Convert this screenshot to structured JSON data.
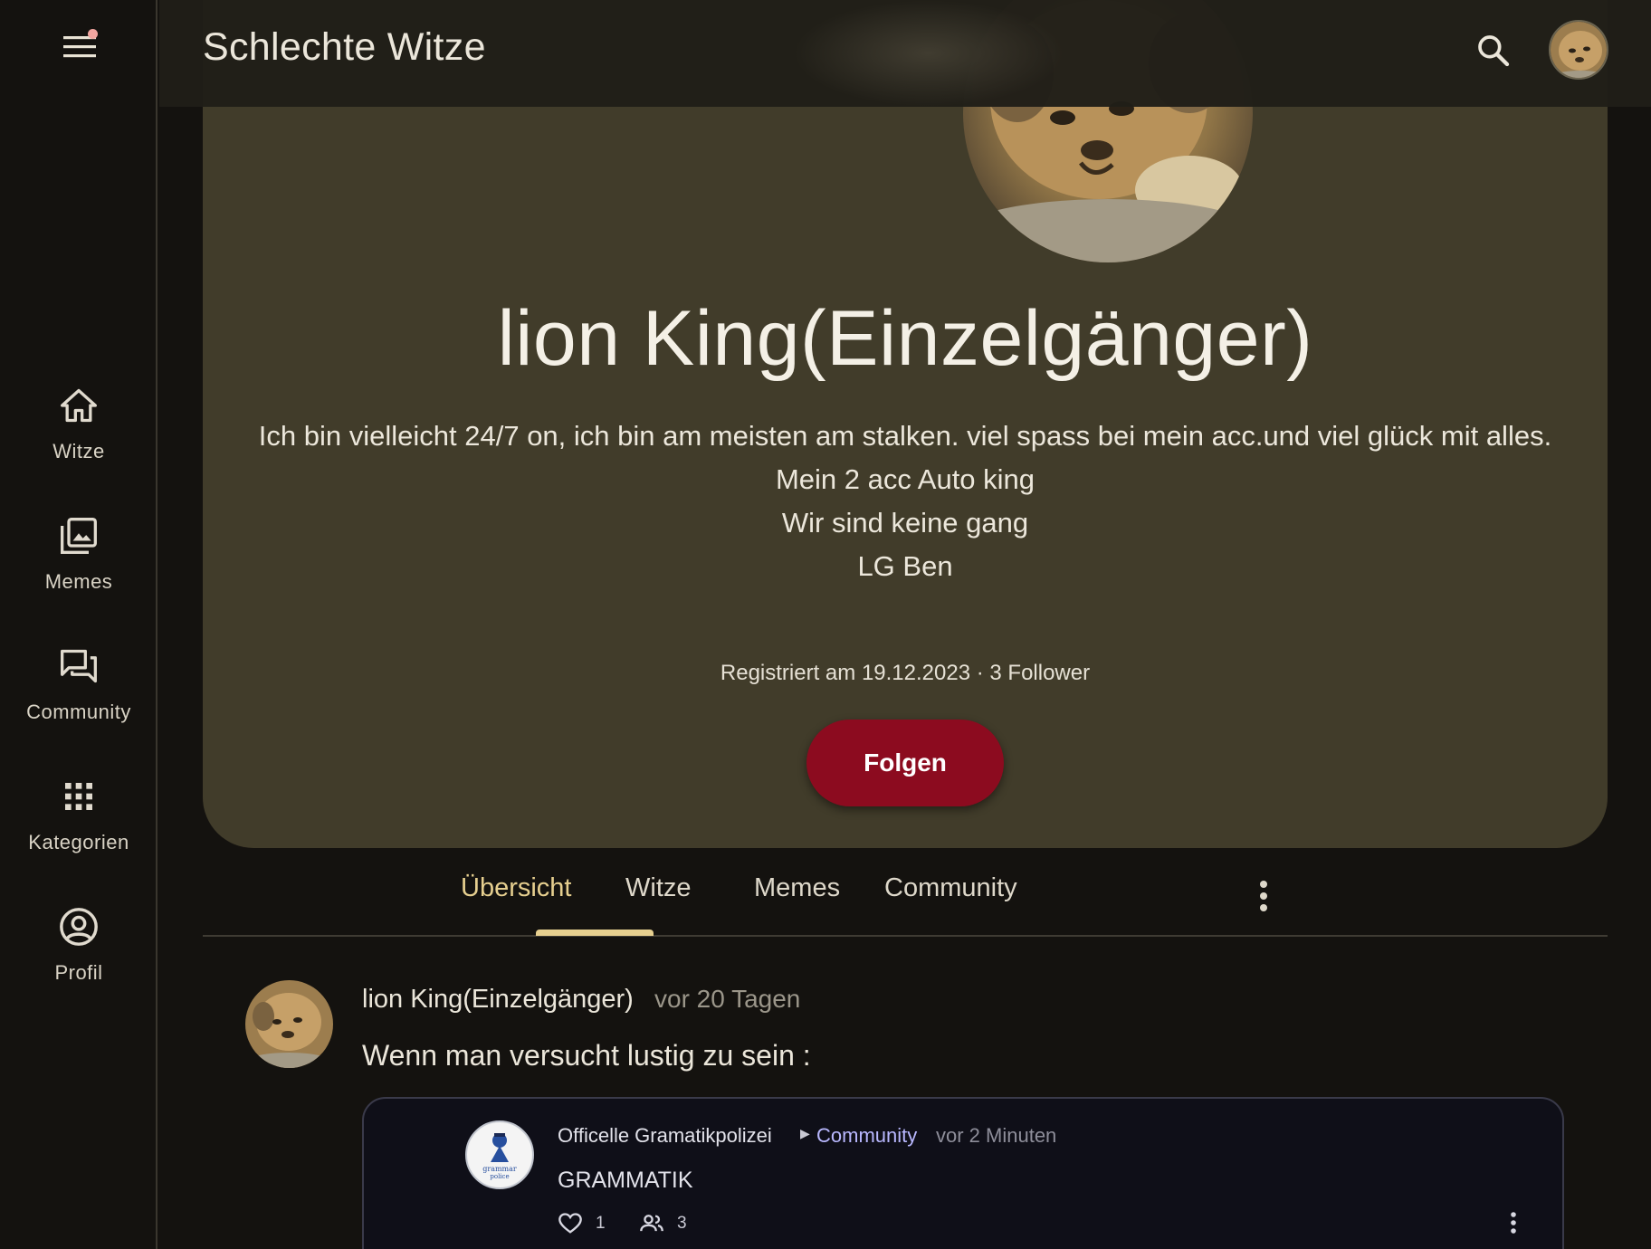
{
  "app": {
    "title": "Schlechte Witze"
  },
  "colors": {
    "background": "#14120f",
    "card": "#413c2a",
    "accent": "#e6cf8f",
    "follow_button": "#8c0b1f",
    "notification_dot": "#f2a6a0",
    "community_link": "#b9b8ff"
  },
  "rail": {
    "menu_icon": "menu-icon",
    "items": [
      {
        "label": "Witze",
        "icon": "home-icon"
      },
      {
        "label": "Memes",
        "icon": "image-library-icon"
      },
      {
        "label": "Community",
        "icon": "forum-icon"
      },
      {
        "label": "Kategorien",
        "icon": "grid-icon"
      },
      {
        "label": "Profil",
        "icon": "account-circle-icon"
      }
    ]
  },
  "profile": {
    "name": "lion King(Einzelgänger)",
    "bio_lines": [
      "Ich bin vielleicht 24/7 on, ich bin am meisten am stalken. viel spass bei mein acc.und viel glück mit alles.",
      "Mein 2 acc Auto king",
      "Wir sind keine gang",
      "LG Ben"
    ],
    "meta": "Registriert am 19.12.2023 · 3 Follower",
    "follow_label": "Folgen"
  },
  "tabs": [
    {
      "label": "Übersicht",
      "active": true
    },
    {
      "label": "Witze",
      "active": false
    },
    {
      "label": "Memes",
      "active": false
    },
    {
      "label": "Community",
      "active": false
    }
  ],
  "post": {
    "author": "lion King(Einzelgänger)",
    "time": "vor 20 Tagen",
    "text": "Wenn man versucht lustig zu sein :",
    "embed": {
      "author": "Officelle Gramatikpolizei",
      "community": "Community",
      "time": "vor 2 Minuten",
      "text": "GRAMMATIK",
      "likes": "1",
      "participants": "3",
      "avatar_text": [
        "grammar",
        "police"
      ]
    }
  }
}
